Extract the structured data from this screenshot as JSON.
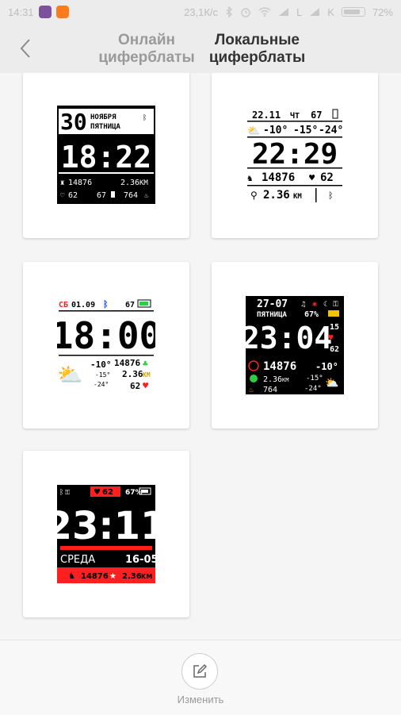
{
  "status_bar": {
    "time": "14:31",
    "speed": "23,1К/с",
    "sim1": "L",
    "sim2": "L",
    "sim2_label": "K",
    "battery": "72%",
    "battery_level": 0.72,
    "icons": [
      "viber-icon",
      "app-icon",
      "bluetooth-icon",
      "alarm-icon",
      "wifi-icon",
      "signal-icon",
      "signal-icon",
      "battery-icon"
    ]
  },
  "header": {
    "back_icon": "chevron-left-icon",
    "tab_online_line1": "Онлайн",
    "tab_online_line2": "циферблаты",
    "tab_local_line1": "Локальные",
    "tab_local_line2": "циферблаты"
  },
  "faces": [
    {
      "name": "watchface-1",
      "date": "30",
      "month": "НОЯБРЯ",
      "weekday": "ПЯТНИЦА",
      "time": "18:22",
      "steps": "14876",
      "distance": "2.36",
      "distance_unit": "KM",
      "heart": "62",
      "battery": "67",
      "calories": "764"
    },
    {
      "name": "watchface-2",
      "date": "22.11",
      "weekday": "ЧТ",
      "battery": "67",
      "temp": "-10°",
      "temp_max": "-15°",
      "temp_min": "-24°",
      "time": "22:29",
      "steps": "14876",
      "heart": "62",
      "distance": "2.36",
      "distance_unit": "KM"
    },
    {
      "name": "watchface-3",
      "weekday": "СБ",
      "date": "01.09",
      "battery": "67",
      "time": "18:00",
      "temp": "-10°",
      "temp_max": "-15°",
      "temp_min": "-24°",
      "steps": "14876",
      "distance": "2.36",
      "distance_unit": "KM",
      "heart": "62"
    },
    {
      "name": "watchface-4",
      "date": "27-07",
      "weekday": "ПЯТНИЦА",
      "battery": "67%",
      "time": "23:04",
      "seconds": "15",
      "heart": "62",
      "steps": "14876",
      "temp": "-10°",
      "distance": "2.36",
      "distance_unit": "KM",
      "temp_max": "-15°",
      "temp_min": "-24°",
      "calories": "764"
    },
    {
      "name": "watchface-5",
      "heart": "62",
      "battery": "67%",
      "time": "23:11",
      "weekday": "СРЕДА",
      "date": "16-05",
      "steps": "14876",
      "distance": "2.36",
      "distance_unit": "KM"
    }
  ],
  "bottom_bar": {
    "edit_icon": "edit-icon",
    "edit_label": "Изменить"
  },
  "colors": {
    "background": "#f5f5f5",
    "header_bg": "#ececec",
    "card_bg": "#ffffff",
    "tab_inactive": "#9a9a9a",
    "tab_active": "#333333",
    "accent_red": "#ff1f1f",
    "accent_green": "#2ecc40",
    "accent_blue": "#1a4dff"
  }
}
